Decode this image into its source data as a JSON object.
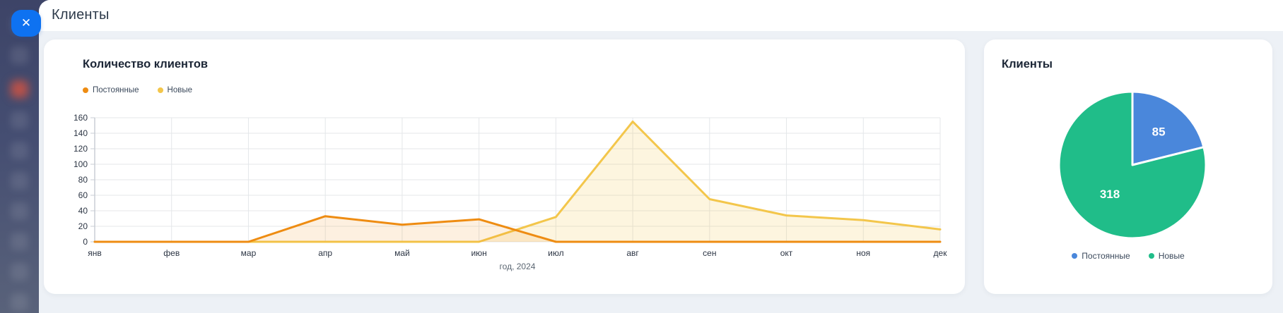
{
  "page": {
    "title": "Клиенты",
    "background": "#edf1f6",
    "topbar_background": "#ffffff"
  },
  "close_button": {
    "icon": "✕",
    "color": "#0e72f1"
  },
  "chart_data": [
    {
      "type": "area",
      "title": "Количество клиентов",
      "categories": [
        "янв",
        "фев",
        "мар",
        "апр",
        "май",
        "июн",
        "июл",
        "авг",
        "сен",
        "окт",
        "ноя",
        "дек"
      ],
      "series": [
        {
          "name": "Постоянные",
          "color": "#ee8c12",
          "fill": "rgba(238,140,18,0.13)",
          "values": [
            0,
            0,
            0,
            33,
            22,
            29,
            0,
            0,
            0,
            0,
            0,
            0
          ]
        },
        {
          "name": "Новые",
          "color": "#f3c64b",
          "fill": "rgba(243,198,75,0.18)",
          "values": [
            0,
            0,
            0,
            0,
            0,
            0,
            32,
            155,
            55,
            34,
            28,
            16
          ]
        }
      ],
      "xlabel": "год, 2024",
      "ylabel": "",
      "ylim": [
        0,
        160
      ],
      "ytick_step": 20,
      "grid": true,
      "legend_position": "top-left"
    },
    {
      "type": "pie",
      "title": "Клиенты",
      "labels": [
        "Постоянные",
        "Новые"
      ],
      "values": [
        85,
        318
      ],
      "colors": [
        "#4a87db",
        "#20bd89"
      ],
      "legend_position": "bottom"
    }
  ]
}
